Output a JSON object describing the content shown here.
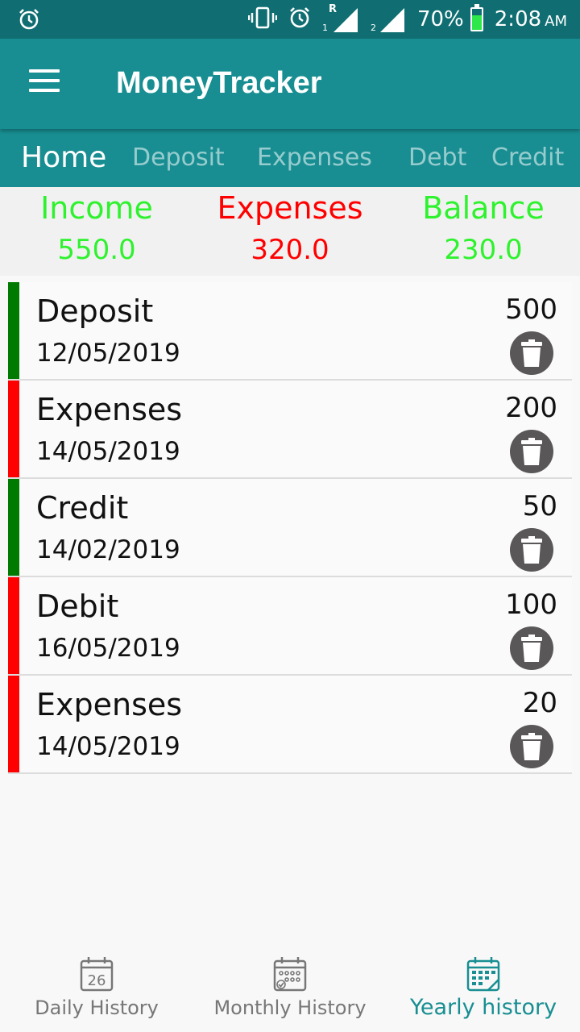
{
  "status_bar": {
    "battery": "70%",
    "battery_level": 0.7,
    "time": "2:08",
    "ampm": "AM",
    "sim1_label": "R",
    "sim1_index": "1",
    "sim2_index": "2"
  },
  "app": {
    "title": "MoneyTracker",
    "accent_color": "#188e92",
    "statusbar_color": "#106e72"
  },
  "tabs": [
    {
      "label": "Home",
      "active": true
    },
    {
      "label": "Deposit",
      "active": false
    },
    {
      "label": "Expenses",
      "active": false
    },
    {
      "label": "Debt",
      "active": false
    },
    {
      "label": "Credit",
      "active": false
    }
  ],
  "summary": {
    "income": {
      "label": "Income",
      "value": "550.0",
      "color": "#2ef22e"
    },
    "expenses": {
      "label": "Expenses",
      "value": "320.0",
      "color": "#ff0000"
    },
    "balance": {
      "label": "Balance",
      "value": "230.0",
      "color": "#2ef22e"
    }
  },
  "transactions": [
    {
      "title": "Deposit",
      "date": "12/05/2019",
      "amount": "500",
      "color": "#007a00",
      "icon": "trash-icon"
    },
    {
      "title": "Expenses",
      "date": "14/05/2019",
      "amount": "200",
      "color": "#ff0000",
      "icon": "trash-icon"
    },
    {
      "title": "Credit",
      "date": "14/02/2019",
      "amount": "50",
      "color": "#007a00",
      "icon": "trash-icon"
    },
    {
      "title": "Debit",
      "date": "16/05/2019",
      "amount": "100",
      "color": "#ff0000",
      "icon": "trash-icon"
    },
    {
      "title": "Expenses",
      "date": "14/05/2019",
      "amount": "20",
      "color": "#ff0000",
      "icon": "trash-icon"
    }
  ],
  "bottom_nav": {
    "items": [
      {
        "label": "Daily History",
        "icon": "calendar-day-icon",
        "icon_text": "26",
        "active": false
      },
      {
        "label": "Monthly History",
        "icon": "calendar-month-icon",
        "active": false
      },
      {
        "label": "Yearly history",
        "icon": "calendar-year-icon",
        "active": true
      }
    ]
  }
}
